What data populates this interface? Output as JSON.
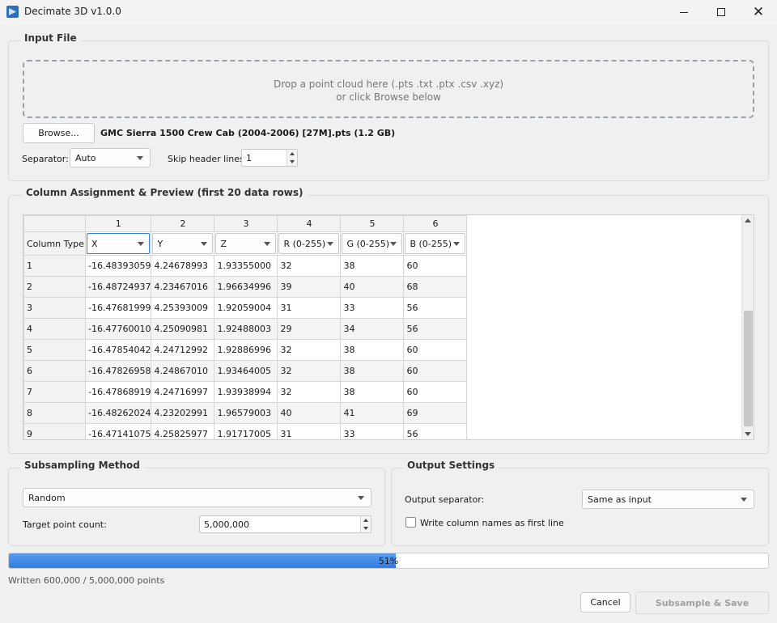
{
  "window": {
    "title": "Decimate 3D  v1.0.0"
  },
  "input_file": {
    "group_title": "Input File",
    "drop_line1": "Drop a point cloud here  (.pts  .txt  .ptx  .csv  .xyz)",
    "drop_line2": "or click Browse below",
    "browse_label": "Browse...",
    "filename": "GMC Sierra 1500 Crew Cab (2004-2006) [27M].pts   (1.2 GB)",
    "separator_label": "Separator:",
    "separator_value": "Auto",
    "skip_label": "Skip header lines:",
    "skip_value": "1"
  },
  "preview": {
    "group_title": "Column Assignment  &  Preview  (first 20 data rows)",
    "column_numbers": [
      "1",
      "2",
      "3",
      "4",
      "5",
      "6"
    ],
    "type_row_label": "Column Type",
    "column_types": [
      "X",
      "Y",
      "Z",
      "R (0-255)",
      "G (0-255)",
      "B (0-255)"
    ],
    "rows": [
      {
        "label": "1",
        "cells": [
          "-16.48393059",
          "4.24678993",
          "1.93355000",
          "32",
          "38",
          "60"
        ]
      },
      {
        "label": "2",
        "cells": [
          "-16.48724937",
          "4.23467016",
          "1.96634996",
          "39",
          "40",
          "68"
        ]
      },
      {
        "label": "3",
        "cells": [
          "-16.47681999",
          "4.25393009",
          "1.92059004",
          "31",
          "33",
          "56"
        ]
      },
      {
        "label": "4",
        "cells": [
          "-16.47760010",
          "4.25090981",
          "1.92488003",
          "29",
          "34",
          "56"
        ]
      },
      {
        "label": "5",
        "cells": [
          "-16.47854042",
          "4.24712992",
          "1.92886996",
          "32",
          "38",
          "60"
        ]
      },
      {
        "label": "6",
        "cells": [
          "-16.47826958",
          "4.24867010",
          "1.93464005",
          "32",
          "38",
          "60"
        ]
      },
      {
        "label": "7",
        "cells": [
          "-16.47868919",
          "4.24716997",
          "1.93938994",
          "32",
          "38",
          "60"
        ]
      },
      {
        "label": "8",
        "cells": [
          "-16.48262024",
          "4.23202991",
          "1.96579003",
          "40",
          "41",
          "69"
        ]
      },
      {
        "label": "9",
        "cells": [
          "-16.47141075",
          "4.25825977",
          "1.91717005",
          "31",
          "33",
          "56"
        ]
      }
    ]
  },
  "subsampling": {
    "group_title": "Subsampling Method",
    "method_value": "Random",
    "target_label": "Target point count:",
    "target_value": "5,000,000"
  },
  "output": {
    "group_title": "Output Settings",
    "separator_label": "Output separator:",
    "separator_value": "Same as input",
    "header_checkbox_label": "Write column names as first line",
    "header_checked": false
  },
  "progress": {
    "percent": 51,
    "percent_text": "51%",
    "status": "Written 600,000 / 5,000,000 points"
  },
  "actions": {
    "cancel_label": "Cancel",
    "save_label": "Subsample & Save"
  },
  "colors": {
    "accent": "#2f7de1"
  }
}
